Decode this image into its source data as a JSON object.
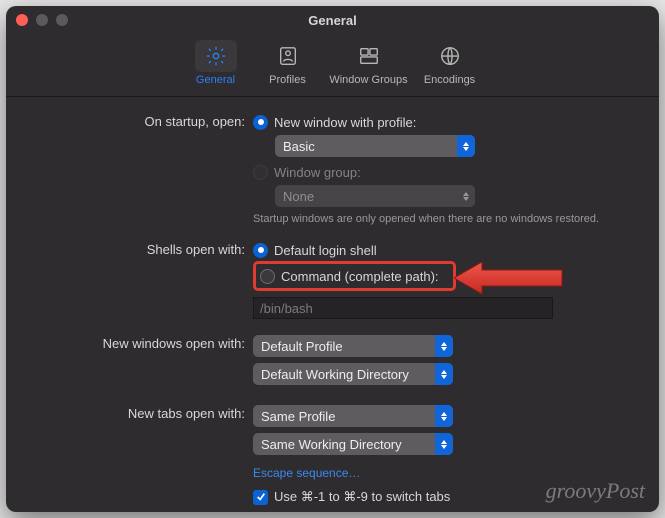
{
  "window": {
    "title": "General"
  },
  "toolbar": {
    "tabs": [
      {
        "label": "General",
        "icon": "gear-icon",
        "selected": true
      },
      {
        "label": "Profiles",
        "icon": "profile-icon",
        "selected": false
      },
      {
        "label": "Window Groups",
        "icon": "windows-icon",
        "selected": false
      },
      {
        "label": "Encodings",
        "icon": "globe-icon",
        "selected": false
      }
    ]
  },
  "general": {
    "startup": {
      "label": "On startup, open:",
      "options": {
        "new_window": "New window with profile:",
        "window_group": "Window group:"
      },
      "profile_popup": "Basic",
      "group_popup": "None",
      "hint": "Startup windows are only opened when there are no windows restored."
    },
    "shells": {
      "label": "Shells open with:",
      "options": {
        "default": "Default login shell",
        "command": "Command (complete path):"
      },
      "command_path": "/bin/bash"
    },
    "new_windows": {
      "label": "New windows open with:",
      "profile_popup": "Default Profile",
      "dir_popup": "Default Working Directory"
    },
    "new_tabs": {
      "label": "New tabs open with:",
      "profile_popup": "Same Profile",
      "dir_popup": "Same Working Directory"
    },
    "escape_link": "Escape sequence…",
    "switch_tabs_check": "Use ⌘-1 to ⌘-9 to switch tabs"
  },
  "watermark": "groovyPost"
}
